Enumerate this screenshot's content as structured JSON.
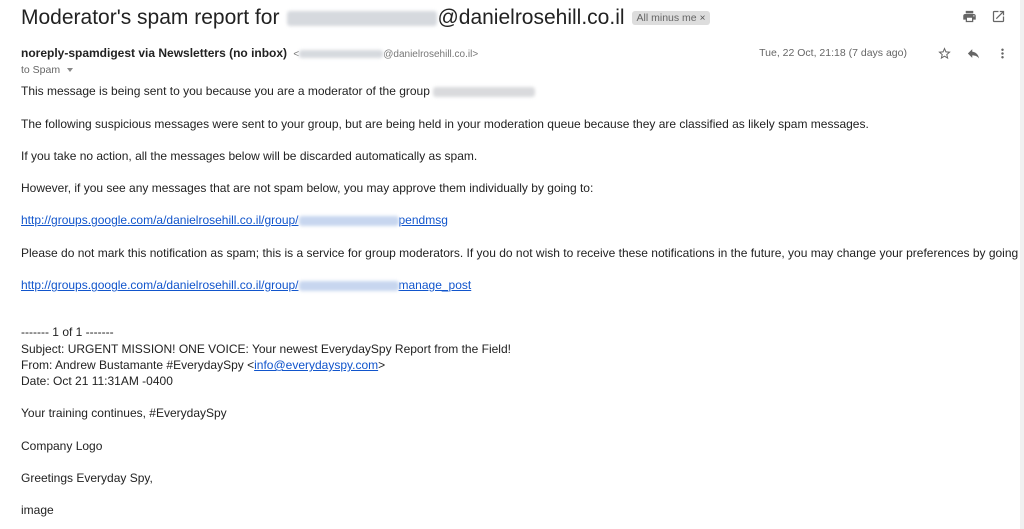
{
  "header": {
    "subject_prefix": "Moderator's spam report for",
    "subject_domain": "@danielrosehill.co.il",
    "label_chip": "All minus me",
    "label_remove_glyph": "×"
  },
  "toolbar_icons": [
    "print-icon",
    "open-in-new-window-icon"
  ],
  "sender": {
    "name": "noreply-spamdigest via Newsletters (no inbox)",
    "email_prefix": "<",
    "email_domain": "@danielrosehill.co.il>",
    "to_line": "to Spam",
    "date": "Tue, 22 Oct, 21:18 (7 days ago)"
  },
  "message_icons": [
    "star-icon",
    "reply-icon",
    "more-vert-icon"
  ],
  "body": {
    "p1": "This message is being sent to you because you are a moderator of the group",
    "p2": "The following suspicious messages were sent to your group, but are being held in your moderation queue because they are classified as likely spam messages.",
    "p3": "If you take no action, all the messages below will be discarded automatically as spam.",
    "p4": "However, if you see any messages that are not spam below, you may approve them individually by going to:",
    "link1_prefix": "http://groups.google.com/a/danielrosehill.co.il/group/",
    "link1_suffix": "pendmsg",
    "p5": "Please do not mark this notification as spam; this is a service for group moderators. If you do not wish to receive these notifications in the future, you may change your preferences by going to:",
    "link2_prefix": "http://groups.google.com/a/danielrosehill.co.il/group/",
    "link2_suffix": "manage_post",
    "separator": "------- 1 of 1  -------",
    "msg_subject": "Subject: URGENT MISSION! ONE VOICE: Your newest EverydaySpy Report from the Field!",
    "msg_from_prefix": "From: Andrew Bustamante #EverydaySpy <",
    "msg_from_email": "info@everydayspy.com",
    "msg_from_suffix": ">",
    "msg_date": "Date: Oct 21 11:31AM -0400",
    "line_training": "Your training continues, #EverydaySpy",
    "line_logo": "Company Logo",
    "line_greeting": "Greetings Everyday Spy,",
    "line_image": "image"
  }
}
